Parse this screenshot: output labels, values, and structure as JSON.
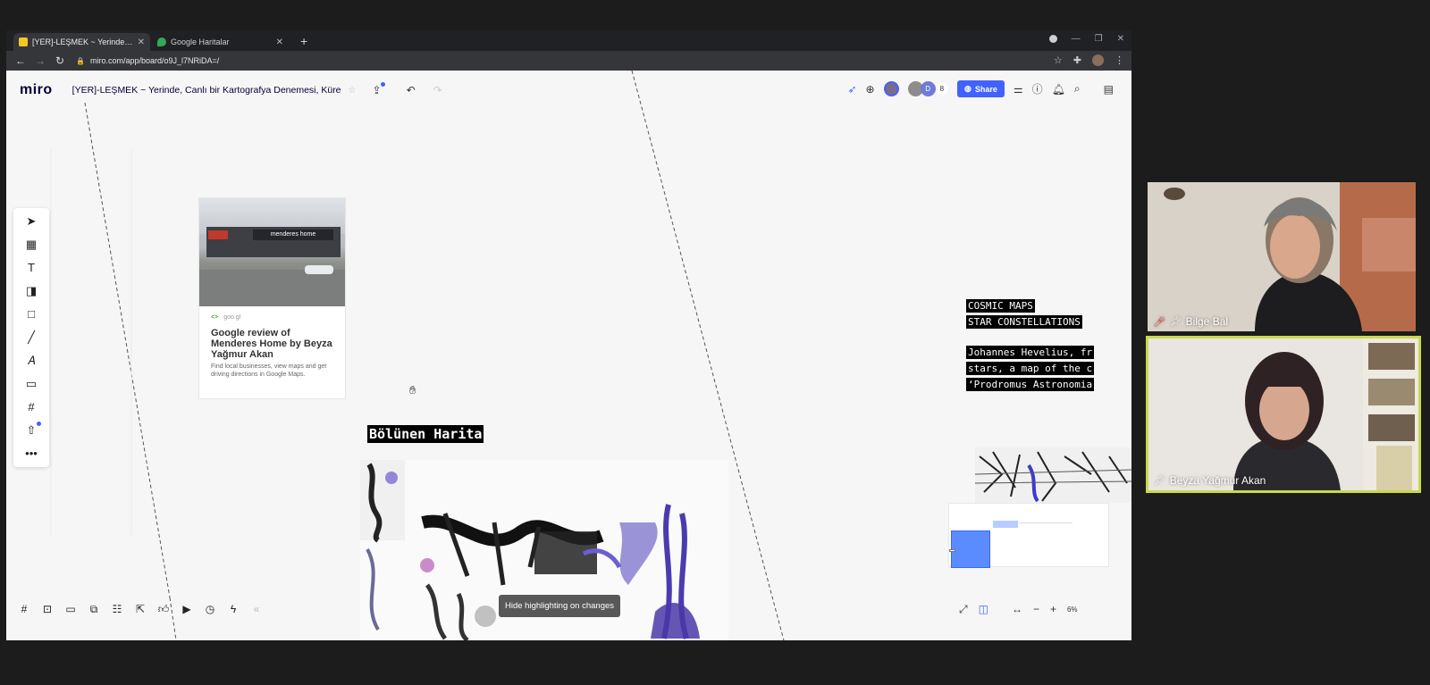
{
  "browser": {
    "tabs": [
      {
        "title": "[YER]-LEŞMEK ~ Yerinde, Canlı bi",
        "favicon_color": "#f7c825",
        "active": true
      },
      {
        "title": "Google Haritalar",
        "favicon_color": "#34a853",
        "active": false
      }
    ],
    "url": "miro.com/app/board/o9J_l7NRiDA=/"
  },
  "miro": {
    "logo": "miro",
    "board_title": "[YER]-LEŞMEK ~ Yerinde, Canlı bir Kartografya Denemesi, Küre",
    "collaborator_count": "8",
    "collaborator_initial": "D",
    "share_label": "Share",
    "accent_color": "#4262ff"
  },
  "review_card": {
    "source": "goo.gl",
    "store_sign": "menderes home",
    "title": "Google review of Menderes Home by Beyza Yağmur Akan",
    "description": "Find local businesses, view maps and get driving directions in Google Maps."
  },
  "board_labels": {
    "bolunen": "Bölünen Harita",
    "cosmic_1": "COSMIC MAPS",
    "cosmic_2": "STAR CONSTELLATIONS",
    "hevelius_1": "Johannes Hevelius, fr",
    "hevelius_2": "stars, a map of the c",
    "hevelius_3": "‘Prodromus Astronomia"
  },
  "highlight_button": "Hide highlighting on changes",
  "zoom_level": "6%",
  "participants": [
    {
      "name": "Bilge Bal",
      "muted": true
    },
    {
      "name": "Beyza Yağmur Akan",
      "muted": false
    }
  ],
  "icons": {
    "left_toolbar": [
      "cursor-icon",
      "template-icon",
      "text-icon",
      "sticky-note-icon",
      "shape-icon",
      "pen-line-icon",
      "pen-icon",
      "comment-icon",
      "frame-icon",
      "upload-icon",
      "more-icon"
    ],
    "bottom_toolbar": [
      "frames-icon",
      "presentation-icon",
      "chat-icon",
      "cards-icon",
      "kanban-icon",
      "share-screen-icon",
      "reaction-icon",
      "video-icon",
      "timer-icon",
      "flash-icon",
      "collapse-icon"
    ]
  }
}
